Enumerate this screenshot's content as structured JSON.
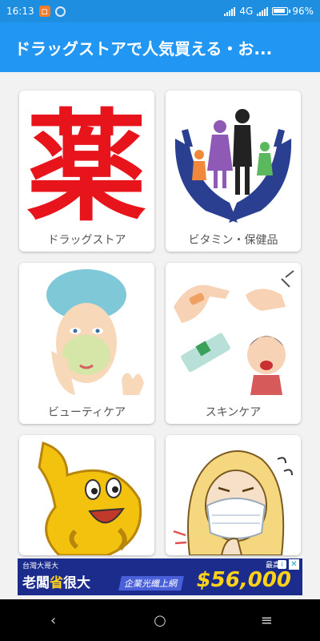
{
  "status_bar": {
    "time": "16:13",
    "badge_glyph": "ロ",
    "network": "4G",
    "battery": "96%"
  },
  "app_bar": {
    "title": "ドラッグストアで人気買える・お..."
  },
  "categories": [
    {
      "label": "ドラッグストア",
      "icon": "kanji-medicine-icon",
      "glyph": "薬"
    },
    {
      "label": "ビタミン・保健品",
      "icon": "family-hands-icon"
    },
    {
      "label": "ビューティケア",
      "icon": "face-mask-woman-icon"
    },
    {
      "label": "スキンケア",
      "icon": "skin-care-icon"
    },
    {
      "label": "",
      "icon": "stomach-character-icon"
    },
    {
      "label": "",
      "icon": "mask-woman-icon"
    }
  ],
  "ad": {
    "top_text": "台灣大哥大",
    "main_text": "老闆",
    "main_badge": "省",
    "main_text2": "很大",
    "sub_text": "企業光纖上網",
    "corner_text": "最高",
    "price": "$56,000",
    "info_glyph": "i",
    "close_glyph": "✕"
  },
  "nav": {
    "back_glyph": "‹",
    "home_glyph": "○",
    "recents_glyph": "≡"
  },
  "colors": {
    "status_bar": "#1e8fe0",
    "app_bar": "#2196f3",
    "kanji_red": "#e8141b",
    "ad_bg": "#1b2c8c",
    "ad_price": "#ffd21a"
  }
}
